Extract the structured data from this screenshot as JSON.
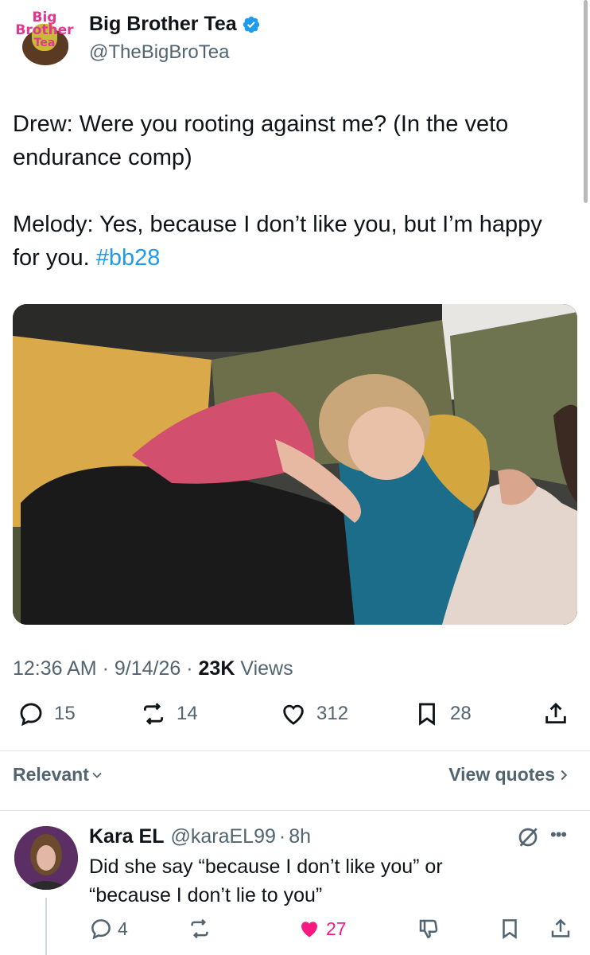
{
  "tweet": {
    "avatar_logo": [
      "Big",
      "Brother",
      "Tea"
    ],
    "display_name": "Big Brother Tea",
    "handle": "@TheBigBroTea",
    "body_line1": "Drew: Were you rooting against me? (In the veto endurance comp)",
    "body_line2": "Melody: Yes, because I don’t like you, but I’m happy for you.",
    "hashtag": "#bb28",
    "time": "12:36 AM",
    "date": "9/14/26",
    "views_count": "23K",
    "views_label": "Views",
    "separator": "·",
    "stats": {
      "replies": "15",
      "reposts": "14",
      "likes": "312",
      "bookmarks": "28"
    }
  },
  "filters": {
    "sort_label": "Relevant",
    "view_quotes_label": "View quotes"
  },
  "reply": {
    "name": "Kara EL",
    "handle": "@karaEL99",
    "separator": "·",
    "time": "8h",
    "text_line1": "Did she say “because I don’t like you” or",
    "text_line2": "“because I don’t lie to you”",
    "stats": {
      "replies": "4",
      "reposts": "",
      "likes": "27"
    }
  },
  "colors": {
    "accent": "#1d9bf0",
    "like": "#f91880",
    "muted": "#536471",
    "text": "#0f1419"
  }
}
